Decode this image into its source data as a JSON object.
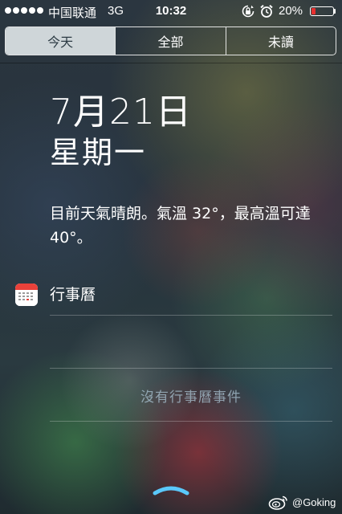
{
  "status_bar": {
    "carrier": "中国联通",
    "network": "3G",
    "time": "10:32",
    "battery_percent_label": "20%",
    "battery_level": 0.2,
    "battery_color": "#e8302f",
    "signal_dots": 5,
    "icons": [
      "orientation-lock-icon",
      "alarm-icon",
      "battery-icon"
    ]
  },
  "tabs": [
    {
      "label": "今天",
      "active": true
    },
    {
      "label": "全部",
      "active": false
    },
    {
      "label": "未讀",
      "active": false
    }
  ],
  "today": {
    "date": "7月21日",
    "weekday": "星期一",
    "weather_summary": "目前天氣晴朗。氣溫 32°，最高溫可達 40°。"
  },
  "calendar": {
    "title": "行事曆",
    "icon": "calendar-icon",
    "empty_message": "沒有行事曆事件"
  },
  "footer": {
    "grabber_icon": "chevron-up-icon",
    "watermark_text": "@Goking",
    "watermark_icon": "weibo-icon"
  },
  "colors": {
    "active_tab_bg": "#cfd6d9",
    "active_tab_text": "#2c3b44",
    "muted_text": "#aac3d2"
  }
}
